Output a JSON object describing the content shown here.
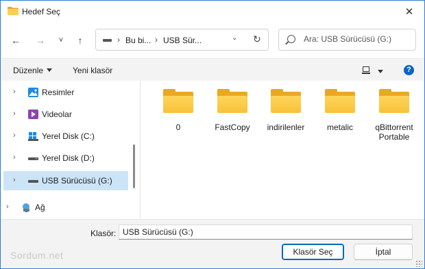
{
  "window": {
    "title": "Hedef Seç"
  },
  "nav": {
    "back": "←",
    "forward": "→",
    "recent": "˅",
    "up": "↑"
  },
  "address": {
    "crumbs": [
      "Bu bi...",
      "USB Sür..."
    ],
    "separator": "›",
    "dropdown": "⌄",
    "refresh": "↻"
  },
  "search": {
    "placeholder": "Ara: USB Sürücüsü (G:)"
  },
  "toolbar": {
    "organize": "Düzenle",
    "new_folder": "Yeni klasör",
    "help": "?"
  },
  "tree": [
    {
      "label": "Resimler",
      "icon": "pictures-icon",
      "selected": false
    },
    {
      "label": "Videolar",
      "icon": "videos-icon",
      "selected": false
    },
    {
      "label": "Yerel Disk (C:)",
      "icon": "windows-drive-icon",
      "selected": false
    },
    {
      "label": "Yerel Disk (D:)",
      "icon": "drive-icon",
      "selected": false
    },
    {
      "label": "USB Sürücüsü (G:)",
      "icon": "usb-drive-icon",
      "selected": true
    },
    {
      "label": "Ağ",
      "icon": "network-icon",
      "selected": false
    }
  ],
  "files": [
    {
      "name": "0"
    },
    {
      "name": "FastCopy"
    },
    {
      "name": "indirilenler"
    },
    {
      "name": "metalic"
    },
    {
      "name": "qBittorrent Portable"
    }
  ],
  "footer": {
    "folder_label": "Klasör:",
    "folder_value": "USB Sürücüsü (G:)",
    "select_button": "Klasör Seç",
    "cancel_button": "İptal",
    "watermark": "Sordum.net"
  },
  "colors": {
    "accent": "#0067c0",
    "selection": "#cce4f7",
    "folder": "#f8c23a"
  }
}
